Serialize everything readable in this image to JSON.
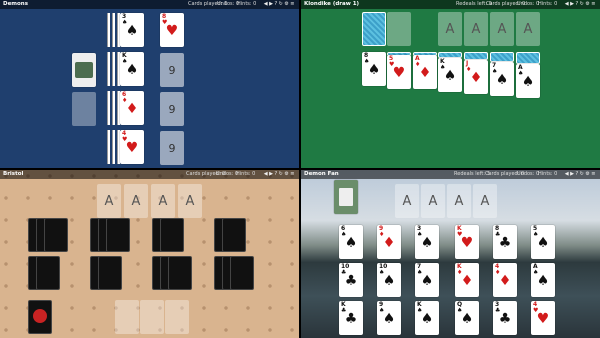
{
  "panels": {
    "demons": {
      "title": "Demons",
      "stats": [
        "Cards played: 1",
        "Undos: 0",
        "Hints: 0"
      ],
      "foundation_counts": [
        "9",
        "9",
        "9"
      ]
    },
    "klondike": {
      "title": "Klondike (draw 1)",
      "stats": [
        "Redeals left: 0",
        "Cards played: 0",
        "Undos: 0",
        "Hints: 0"
      ],
      "foundation_label": "A"
    },
    "bristol": {
      "title": "Bristol",
      "stats": [
        "Cards played: 0",
        "Undos: 0",
        "Hints: 0"
      ],
      "foundation_label": "A"
    },
    "demon_fan": {
      "title": "Demon Fan",
      "stats": [
        "Redeals left: 3",
        "Cards played: 0",
        "Undos: 0",
        "Hints: 0"
      ],
      "foundation_label": "A"
    }
  },
  "colors": {
    "demons_bg": "#1f3f6e",
    "klondike_bg": "#1f7a43",
    "bristol_bg": "#d9b48f",
    "suit_red": "#d21b1b"
  },
  "icons": [
    "back-icon",
    "forward-icon",
    "hint-icon",
    "refresh-icon",
    "settings-icon",
    "menu-icon"
  ],
  "icon_glyphs": [
    "◀",
    "▶",
    "?",
    "↻",
    "⚙",
    "≡"
  ],
  "cards": {
    "demons": [
      {
        "v": "3",
        "s": "♠",
        "red": false
      },
      {
        "v": "8",
        "s": "♥",
        "red": true
      },
      {
        "v": "K",
        "s": "♠",
        "red": false
      },
      {
        "v": "6",
        "s": "♦",
        "red": true
      },
      {
        "v": "4",
        "s": "♥",
        "red": true
      },
      {
        "v": "6",
        "s": "♥",
        "red": true
      }
    ],
    "klondike": [
      {
        "v": "8",
        "s": "♠",
        "red": false
      },
      {
        "v": "5",
        "s": "♥",
        "red": true
      },
      {
        "v": "A",
        "s": "♦",
        "red": true
      },
      {
        "v": "K",
        "s": "♠",
        "red": false
      },
      {
        "v": "J",
        "s": "♦",
        "red": true
      },
      {
        "v": "7",
        "s": "♠",
        "red": false
      },
      {
        "v": "A",
        "s": "♠",
        "red": false
      }
    ],
    "demon_fan": [
      {
        "v": "6",
        "s": "♠",
        "red": false
      },
      {
        "v": "9",
        "s": "♦",
        "red": true
      },
      {
        "v": "3",
        "s": "♠",
        "red": false
      },
      {
        "v": "K",
        "s": "♥",
        "red": true
      },
      {
        "v": "8",
        "s": "♣",
        "red": false
      },
      {
        "v": "5",
        "s": "♠",
        "red": false
      },
      {
        "v": "10",
        "s": "♣",
        "red": false
      },
      {
        "v": "10",
        "s": "♠",
        "red": false
      },
      {
        "v": "7",
        "s": "♠",
        "red": false
      },
      {
        "v": "K",
        "s": "♦",
        "red": true
      },
      {
        "v": "4",
        "s": "♦",
        "red": true
      },
      {
        "v": "A",
        "s": "♠",
        "red": false
      },
      {
        "v": "K",
        "s": "♣",
        "red": false
      },
      {
        "v": "9",
        "s": "♠",
        "red": false
      },
      {
        "v": "K",
        "s": "♠",
        "red": false
      },
      {
        "v": "Q",
        "s": "♠",
        "red": false
      },
      {
        "v": "3",
        "s": "♣",
        "red": false
      },
      {
        "v": "4",
        "s": "♥",
        "red": true
      }
    ]
  }
}
